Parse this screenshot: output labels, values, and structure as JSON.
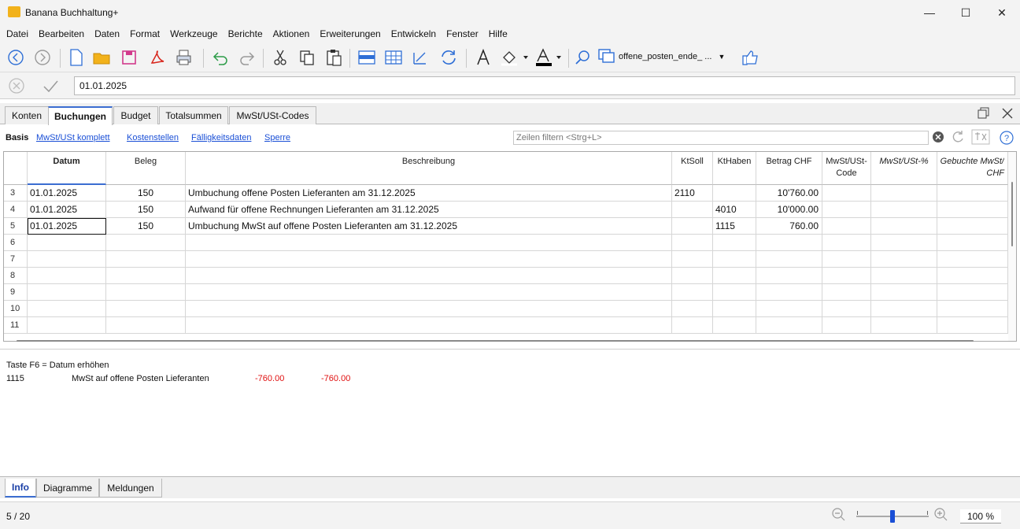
{
  "window": {
    "title": "Banana Buchhaltung+"
  },
  "menu": [
    "Datei",
    "Bearbeiten",
    "Daten",
    "Format",
    "Werkzeuge",
    "Berichte",
    "Aktionen",
    "Erweiterungen",
    "Entwickeln",
    "Fenster",
    "Hilfe"
  ],
  "toolbar": {
    "file_combo": "offene_posten_ende_ ..."
  },
  "editbar": {
    "cell_value": "01.01.2025"
  },
  "tabs": [
    "Konten",
    "Buchungen",
    "Budget",
    "Totalsummen",
    "MwSt/USt-Codes"
  ],
  "views": [
    "Basis",
    "MwSt/USt komplett",
    "Kostenstellen",
    "Fälligkeitsdaten",
    "Sperre"
  ],
  "filter": {
    "placeholder": "Zeilen filtern <Strg+L>"
  },
  "columns": {
    "datum": "Datum",
    "beleg": "Beleg",
    "beschreibung": "Beschreibung",
    "ktsoll": "KtSoll",
    "kthaben": "KtHaben",
    "betrag": "Betrag CHF",
    "mwst_code_1": "MwSt/USt-",
    "mwst_code_2": "Code",
    "mwst_pct": "MwSt/USt-%",
    "geb_mwst_1": "Gebuchte MwSt/",
    "geb_mwst_2": "CHF"
  },
  "rows": [
    {
      "n": "3",
      "datum": "01.01.2025",
      "beleg": "150",
      "beschreibung": "Umbuchung offene Posten Lieferanten am 31.12.2025",
      "ktsoll": "2110",
      "kthaben": "",
      "betrag": "10'760.00"
    },
    {
      "n": "4",
      "datum": "01.01.2025",
      "beleg": "150",
      "beschreibung": "Aufwand für offene Rechnungen Lieferanten am 31.12.2025",
      "ktsoll": "",
      "kthaben": "4010",
      "betrag": "10'000.00"
    },
    {
      "n": "5",
      "datum": "01.01.2025",
      "beleg": "150",
      "beschreibung": "Umbuchung MwSt auf offene Posten Lieferanten am 31.12.2025",
      "ktsoll": "",
      "kthaben": "1115",
      "betrag": "760.00"
    }
  ],
  "empty_rows": [
    "6",
    "7",
    "8",
    "9",
    "10",
    "11"
  ],
  "info": {
    "hint": "Taste F6 = Datum erhöhen",
    "account": "1115",
    "account_name": "MwSt auf offene Posten Lieferanten",
    "value1": "-760.00",
    "value2": "-760.00"
  },
  "bottom_tabs": [
    "Info",
    "Diagramme",
    "Meldungen"
  ],
  "status": {
    "position": "5 / 20",
    "zoom": "100 %",
    "zoom_level": 1.0
  },
  "colors": {
    "accent": "#3b6dd1",
    "link": "#1a4fd6",
    "negative": "#e01010"
  }
}
